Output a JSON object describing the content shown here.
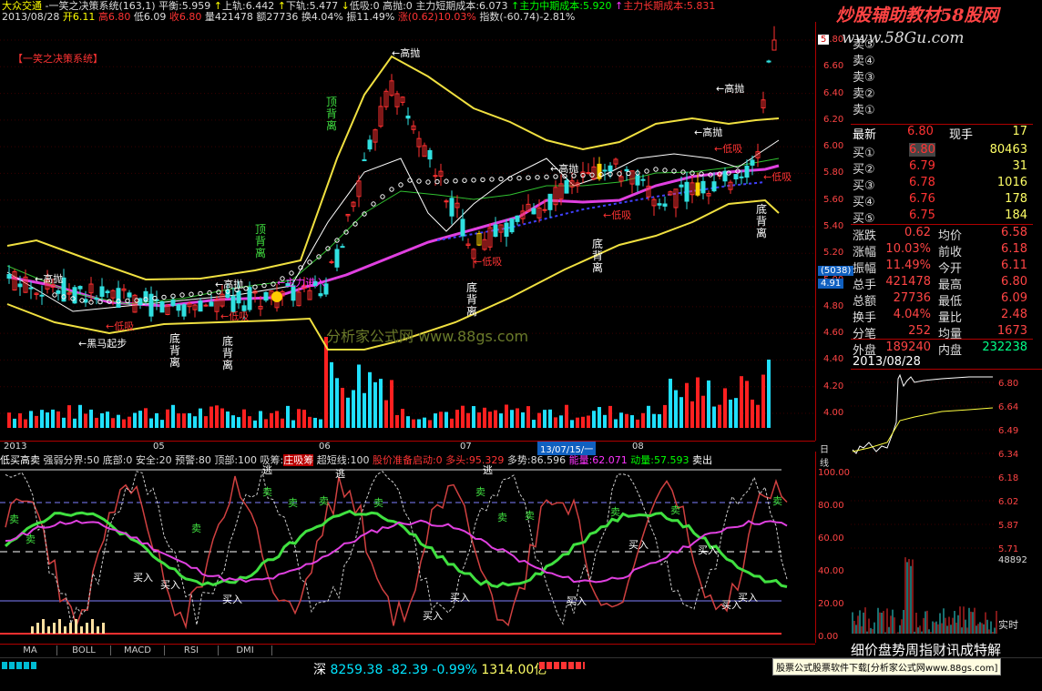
{
  "topbar": {
    "stock": "大众交通",
    "system": "一笑之决策系统",
    "system_params": "(163,1)",
    "balance_label": "平衡",
    "balance": "5.959",
    "upper_label": "上轨",
    "upper": "6.442",
    "lower_label": "下轨",
    "lower": "5.477",
    "low_absorb": "低吸:0",
    "high_throw": "高抛:0",
    "short_cost_label": "主力短期成本",
    "short_cost": "6.073",
    "mid_cost_label": "主力中期成本",
    "mid_cost": "5.920",
    "long_cost_label": "主力长期成本",
    "long_cost": "5.831",
    "date": "2013/08/28",
    "open": "开6.11",
    "high": "高6.80",
    "low": "低6.09",
    "close": "收6.80",
    "volume": "量421478",
    "amount": "额27736",
    "turnover": "换4.04%",
    "amplitude": "振11.49%",
    "change": "涨(0.62)10.03%",
    "index": "指数(-60.74)-2.81%"
  },
  "chart_labels": {
    "system_tag": "【一笑之决策系统】",
    "watermark1": "分析家公式网  www.88gs.com",
    "high_throw": "高抛",
    "low_absorb": "低吸",
    "top_divergence": "顶背离",
    "bottom_divergence": "底背离",
    "black_horse": "黑马起步",
    "main_force": "主力进入"
  },
  "price_axis": [
    "6.80",
    "6.60",
    "6.40",
    "6.20",
    "6.00",
    "5.80",
    "5.60",
    "5.40",
    "5.20",
    "5.00",
    "4.80",
    "4.60",
    "4.40",
    "4.20",
    "4.00"
  ],
  "price_badges": {
    "last": "6.80",
    "level_a": "5",
    "cursor_vol": "(5038)",
    "cursor_price": "4.91"
  },
  "date_axis": {
    "items": [
      "2013",
      "05",
      "06",
      "07",
      "08"
    ],
    "cursor": "13/07/15/一",
    "right": "日线"
  },
  "indicator": {
    "name": "低买高卖",
    "strong_weak": "强弱分界:50",
    "bottom": "底部:0",
    "safe": "安全:20",
    "warning": "预警:80",
    "top": "顶部:100",
    "absorb": "吸筹:",
    "absorb_tag": "庄吸筹",
    "super_short": "超短线:100",
    "stock_price": "股价准备启动:0",
    "bull": "多头:95.329",
    "multi": "多势:86.596",
    "energy": "能量:62.071",
    "momentum": "动量:57.593",
    "sell": "卖出",
    "axis": [
      "100.00",
      "80.00",
      "60.00",
      "40.00",
      "20.00",
      "0.00"
    ],
    "buy": "买入",
    "sell_mark": "卖",
    "escape": "逃"
  },
  "tabs": [
    "MA",
    "BOLL",
    "MACD",
    "RSI",
    "DMI"
  ],
  "logo": {
    "title": "炒股辅助教材58股网",
    "url": "www.58Gu.com"
  },
  "quote": {
    "sells": [
      "卖⑤",
      "卖④",
      "卖③",
      "卖②",
      "卖①"
    ],
    "latest_label": "最新",
    "latest": "6.80",
    "now_hand_label": "现手",
    "now_hand": "17",
    "buys": [
      {
        "label": "买①",
        "price": "6.80",
        "vol": "80463"
      },
      {
        "label": "买②",
        "price": "6.79",
        "vol": "31"
      },
      {
        "label": "买③",
        "price": "6.78",
        "vol": "1016"
      },
      {
        "label": "买④",
        "price": "6.76",
        "vol": "178"
      },
      {
        "label": "买⑤",
        "price": "6.75",
        "vol": "184"
      }
    ],
    "stats": [
      {
        "l1": "涨跌",
        "v1": "0.62",
        "l2": "均价",
        "v2": "6.58"
      },
      {
        "l1": "涨幅",
        "v1": "10.03%",
        "l2": "前收",
        "v2": "6.18"
      },
      {
        "l1": "振幅",
        "v1": "11.49%",
        "l2": "今开",
        "v2": "6.11"
      },
      {
        "l1": "总手",
        "v1": "421478",
        "l2": "最高",
        "v2": "6.80"
      },
      {
        "l1": "总额",
        "v1": "27736",
        "l2": "最低",
        "v2": "6.09"
      },
      {
        "l1": "换手",
        "v1": "4.04%",
        "l2": "量比",
        "v2": "2.48"
      },
      {
        "l1": "分笔",
        "v1": "252",
        "l2": "均量",
        "v2": "1673"
      }
    ],
    "outer_label": "外盘",
    "outer": "189240",
    "inner_label": "内盘",
    "inner": "232238",
    "date": "2013/08/28"
  },
  "mini_axis": [
    "6.80",
    "6.64",
    "6.49",
    "6.34",
    "6.18",
    "6.02",
    "5.87",
    "5.71"
  ],
  "mini_vol": "48892",
  "mini_realtime": "实时",
  "statusbar": {
    "market": "深",
    "index": "8259.38",
    "delta": "-82.39",
    "pct": "-0.99%",
    "amount": "1314.00亿",
    "marquee": "细价盘势周指财讯成特解",
    "promo": "股票公式股票软件下载[分析家公式网www.88gs.com]"
  }
}
